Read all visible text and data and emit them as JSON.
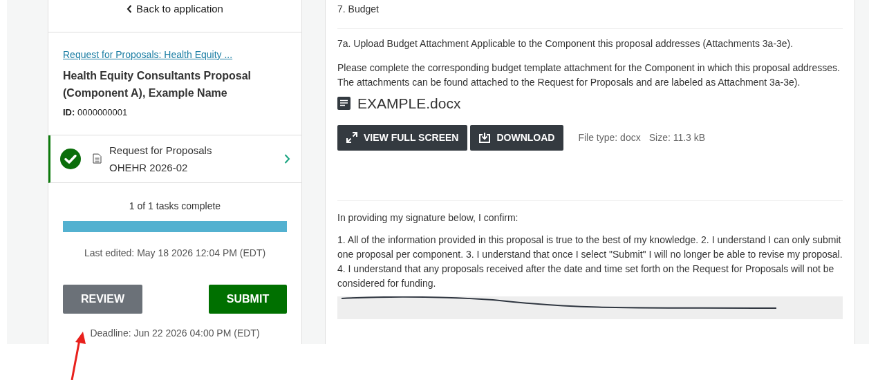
{
  "sidebar": {
    "back_link": "Back to application",
    "rfp_link": "Request for Proposals: Health Equity ...",
    "title": "Health Equity Consultants Proposal (Component A), Example Name",
    "id": "**ID:** 0000000001",
    "tasks": [
      {
        "title": "Request for Proposals",
        "subtitle": "OHEHR 2026-02",
        "completed": true
      }
    ],
    "progress_text": "1 of 1 tasks complete",
    "progress": {
      "level": 1
    },
    "last_edited": "Last edited: May 18 2026 12:04 PM (EDT)",
    "buttons": [
      {
        "label": "REVIEW",
        "kind": "secondary"
      },
      {
        "label": "SUBMIT",
        "kind": "primary"
      }
    ],
    "deadline": "Deadline: Jun 22 2026 04:00 PM (EDT)"
  },
  "main": {
    "section_heading": "7. Budget",
    "question": "7a. Upload Budget Attachment Applicable to the Component this proposal addresses (Attachments 3a-3e).",
    "instructions": "Please complete the corresponding budget template attachment for the Component in which this proposal addresses. The attachments can be found attached to the Request for Proposals and are labeled as Attachment 3a-3e).",
    "file": {
      "name": "EXAMPLE.docx",
      "buttons": [
        {
          "label": "VIEW FULL SCREEN",
          "kind": "fullscreen"
        },
        {
          "label": "DOWNLOAD",
          "kind": "download"
        }
      ],
      "file_type": "File type: docx",
      "size": "Size: 11.3 kB"
    },
    "confirm_intro": "In providing my signature below, I confirm:",
    "confirm_text": "1. All of the information provided in this proposal is true to the best of my knowledge. 2. I understand I can only submit one proposal per component. 3. I understand that once I select \"Submit\" I will no longer be able to revise my proposal. 4. I understand that any proposals received after the date and time set forth on the Request for Proposals will not be considered for funding."
  }
}
